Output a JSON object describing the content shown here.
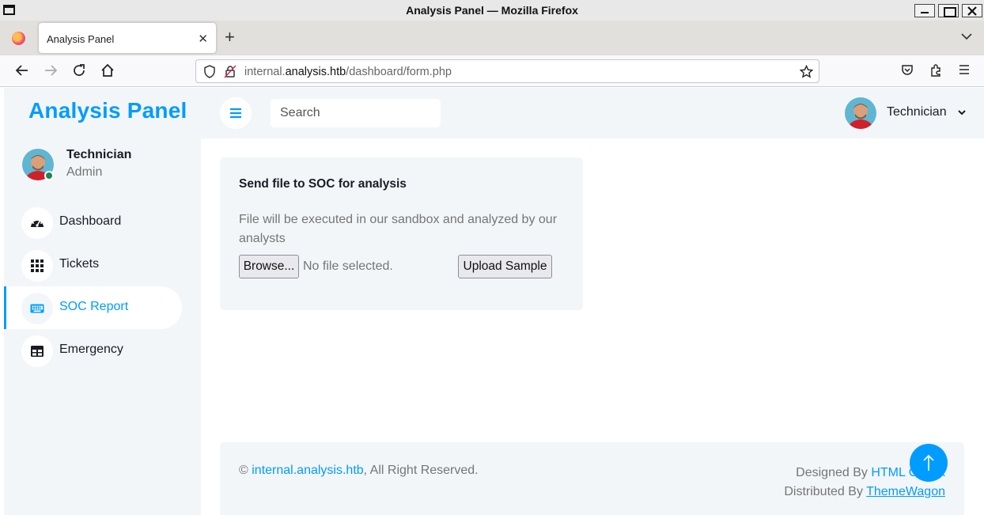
{
  "window": {
    "title": "Analysis Panel — Mozilla Firefox"
  },
  "browser": {
    "tab_title": "Analysis Panel",
    "url_prefix": "internal.",
    "url_host": "analysis.htb",
    "url_path": "/dashboard/form.php"
  },
  "sidebar": {
    "brand": "Analysis Panel",
    "profile": {
      "name": "Technician",
      "role": "Admin",
      "status_color": "#198754"
    },
    "items": [
      {
        "label": "Dashboard",
        "icon": "gauge-icon",
        "active": false
      },
      {
        "label": "Tickets",
        "icon": "grid-icon",
        "active": false
      },
      {
        "label": "SOC Report",
        "icon": "keyboard-icon",
        "active": true
      },
      {
        "label": "Emergency",
        "icon": "table-icon",
        "active": false
      }
    ]
  },
  "topbar": {
    "search_placeholder": "Search",
    "user_name": "Technician"
  },
  "upload_form": {
    "title": "Send file to SOC for analysis",
    "description": "File will be executed in our sandbox and analyzed by our analysts",
    "browse_label": "Browse...",
    "file_status": "No file selected.",
    "upload_label": "Upload Sample"
  },
  "footer": {
    "copyright_symbol": "©",
    "site_link": "internal.analysis.htb",
    "rights": ", All Right Reserved.",
    "designed_by_prefix": "Designed By ",
    "designed_by_link": "HTML Codex",
    "distributed_by_prefix": "Distributed By ",
    "distributed_by_link": "ThemeWagon"
  },
  "colors": {
    "accent": "#009cff",
    "panel_bg": "#f3f6f9",
    "heading": "#191c24",
    "text": "#757575"
  }
}
